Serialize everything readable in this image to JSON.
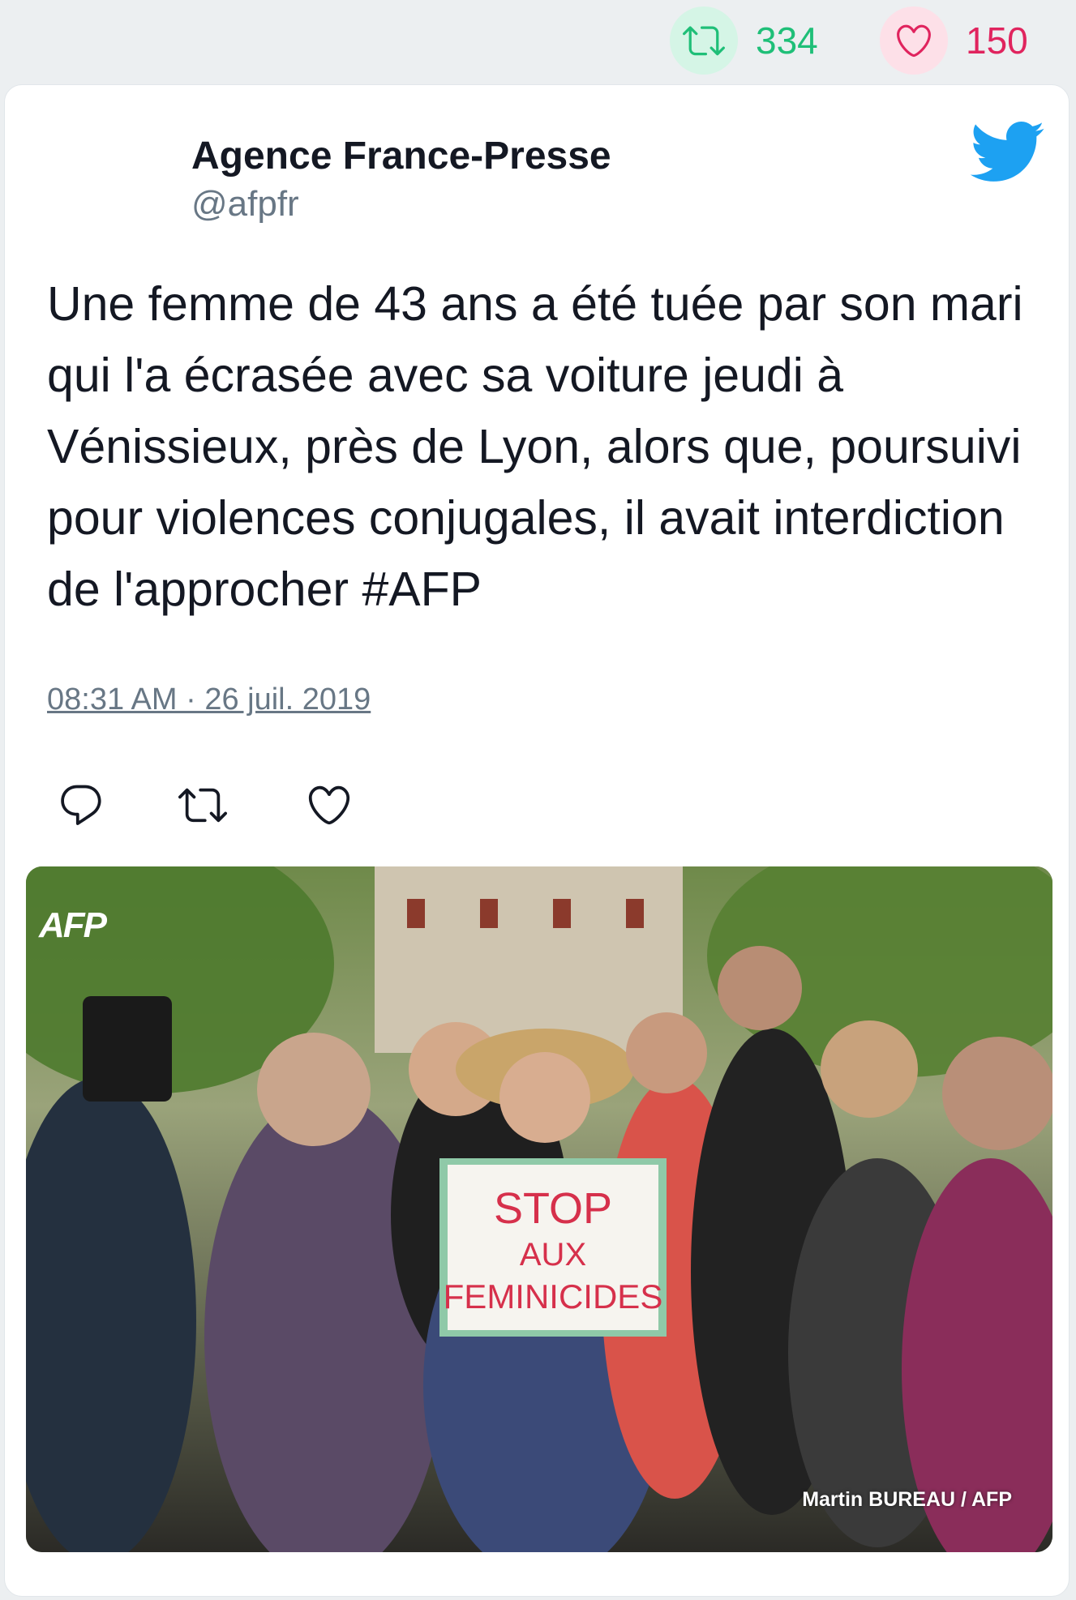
{
  "stats": {
    "retweet_count": "334",
    "like_count": "150"
  },
  "author": {
    "name": "Agence France-Presse",
    "handle": "@afpfr"
  },
  "tweet": {
    "text": "Une femme de 43 ans a été tuée par son mari qui l'a écrasée avec sa voiture jeudi à Vénissieux, près de Lyon, alors que, poursuivi pour violences conjugales, il avait interdiction de l'approcher #AFP",
    "timestamp": "08:31 AM · 26 juil. 2019"
  },
  "media": {
    "logo_text": "AFP",
    "sign_lines": [
      "STOP",
      "AUX",
      "FEMINICIDES"
    ],
    "credit": "Martin BUREAU / AFP"
  },
  "colors": {
    "retweet": "#1fbf78",
    "like": "#e0245e",
    "twitter_blue": "#1da1f2"
  }
}
